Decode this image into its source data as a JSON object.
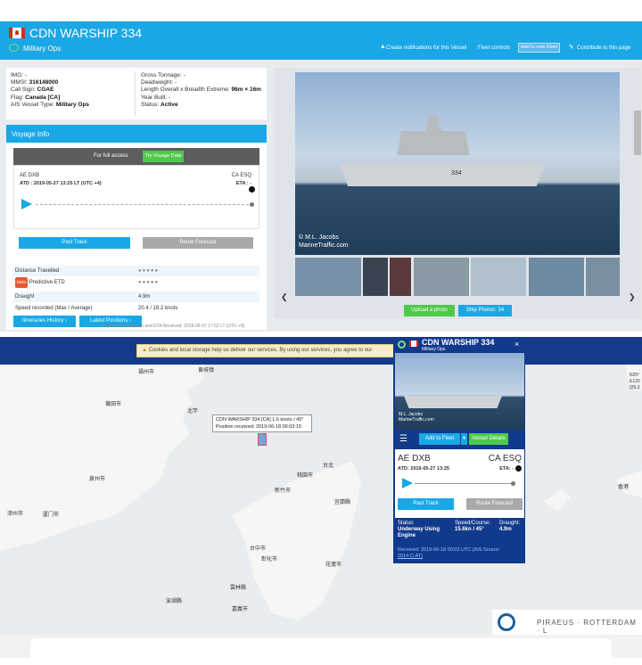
{
  "vessel": {
    "name": "CDN WARSHIP 334",
    "type": "Military Ops"
  },
  "header_links": {
    "notifications": "Create notifications for this Vessel",
    "fleet_controls": "Fleet controls",
    "add_to_fleet": "Add to new Fleet",
    "contribute": "Contribute to this page"
  },
  "info": {
    "imo": "IMO: -",
    "mmsi_label": "MMSI:",
    "mmsi": "316148000",
    "callsign_label": "Call Sign:",
    "callsign": "CGAE",
    "flag_label": "Flag:",
    "flag": "Canada [CA]",
    "ais_label": "AIS Vessel Type:",
    "ais": "Military Ops",
    "gross": "Gross Tonnage: -",
    "deadweight": "Deadweight: -",
    "length_label": "Length Overall x Breadth Extreme:",
    "length": "96m × 16m",
    "year": "Year Built: -",
    "status_label": "Status:",
    "status": "Active"
  },
  "voyage": {
    "title": "Voyage Info",
    "full_access": "For full access",
    "try": "Try Voyage Data",
    "from": "AE DXB",
    "to": "CA ESQ",
    "atd": "ATD : 2019-05-27 13:25 LT (UTC +4)",
    "eta": "ETA : -",
    "past_track": "Past Track",
    "route_forecast": "Route Forecast",
    "distance": "Distance Travelled",
    "beta": "beta",
    "predictive": "Predictive ETD",
    "dots": "●●●●●",
    "draught_label": "Draught",
    "draught": "4.9m",
    "speed_label": "Speed recorded (Max / Average)",
    "speed": "20.4 / 18.2 knots",
    "itineraries": "Itineraries History",
    "latest": "Latest Positions",
    "reported": "Reported Destination and ETA Received: 2019-06-07 17:52 LT (UTC +8)"
  },
  "photo": {
    "credit1": "© M.L. Jacobs",
    "credit2": "MarineTraffic.com",
    "upload": "Upload a photo",
    "ship_photos": "Ship Photos: 34",
    "hull": "334"
  },
  "map": {
    "cookie": "Cookies and local storage help us deliver our services. By using our services, you agree to our",
    "tooltip1": "CDN WARSHIP 334 [CA] 1.6 knots / 45°",
    "tooltip2": "Position received: 2019-06-18 00:03:15",
    "labels": [
      "福州市",
      "黄岐镇",
      "莆田市",
      "泉州市",
      "厦门市",
      "漳州市",
      "桃園市",
      "台北",
      "新竹市",
      "宜蘭縣",
      "台中市",
      "彰化市",
      "花蓮市",
      "雲林縣",
      "嘉義市",
      "澎湖縣",
      "北竿",
      "香港"
    ],
    "coord": "N25° E120 (25.3",
    "ports": "PIRAEUS · ROTTERDAM · L"
  },
  "card": {
    "name": "CDN WARSHIP 334",
    "type": "Military Ops",
    "close": "×",
    "add_fleet": "Add to Fleet",
    "vessel_details": "Vessel Details",
    "from": "AE DXB",
    "to": "CA ESQ",
    "atd": "ATD: 2019-05-27 13:25",
    "eta": "ETA: -",
    "past_track": "Past Track",
    "route_forecast": "Route Forecast",
    "status_label": "Status:",
    "status": "Underway Using Engine",
    "speed_label": "Speed/Course:",
    "speed": "15.6kn / 45°",
    "draught_label": "Draught:",
    "draught": "4.9m",
    "received": "Received: 2019-06-18 00:03 UTC (AIS Source:",
    "source": "2014 C-AT)",
    "credit": "M.L. Jacobs MarineTraffic.com"
  },
  "colors": {
    "brand": "#1aa7e6",
    "navy": "#163a8a",
    "green": "#4ec94a"
  }
}
